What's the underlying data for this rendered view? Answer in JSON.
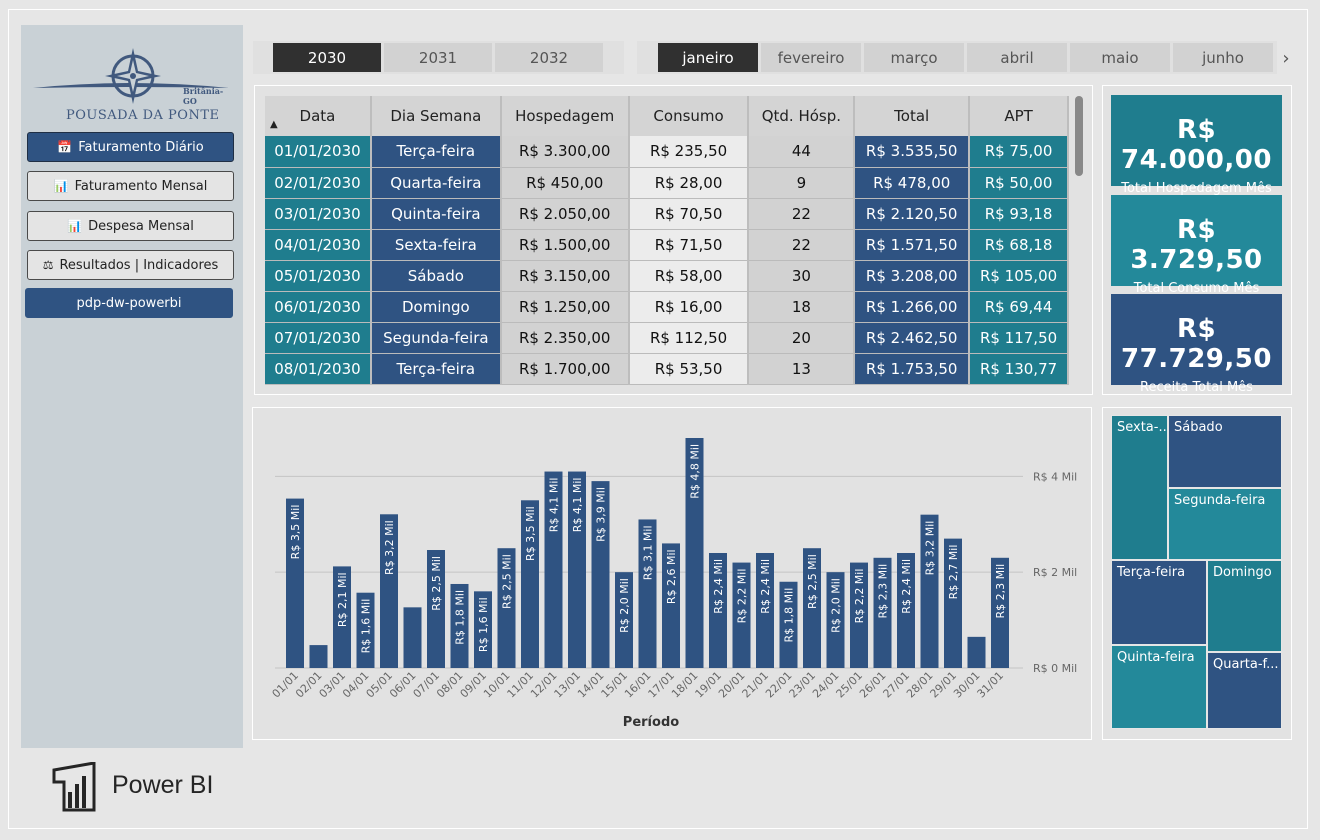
{
  "sidebar": {
    "logo": {
      "name": "Pousada da Ponte",
      "subtitle": "Britânia-GO"
    },
    "buttons": [
      {
        "label": "Faturamento Diário",
        "icon": "calendar-icon"
      },
      {
        "label": "Faturamento Mensal",
        "icon": "bar-chart-icon"
      },
      {
        "label": "Despesa Mensal",
        "icon": "bar-chart-icon"
      },
      {
        "label": "Resultados | Indicadores",
        "icon": "scale-icon"
      },
      {
        "label": "pdp-dw-powerbi",
        "icon": ""
      }
    ],
    "brand": "Power BI"
  },
  "years": [
    "2030",
    "2031",
    "2032"
  ],
  "selected_year": "2030",
  "months": [
    "janeiro",
    "fevereiro",
    "março",
    "abril",
    "maio",
    "junho"
  ],
  "selected_month": "janeiro",
  "table": {
    "columns": [
      "Data",
      "Dia Semana",
      "Hospedagem",
      "Consumo",
      "Qtd. Hósp.",
      "Total",
      "APT"
    ],
    "rows": [
      [
        "01/01/2030",
        "Terça-feira",
        "R$ 3.300,00",
        "R$ 235,50",
        "44",
        "R$ 3.535,50",
        "R$ 75,00"
      ],
      [
        "02/01/2030",
        "Quarta-feira",
        "R$ 450,00",
        "R$ 28,00",
        "9",
        "R$ 478,00",
        "R$ 50,00"
      ],
      [
        "03/01/2030",
        "Quinta-feira",
        "R$ 2.050,00",
        "R$ 70,50",
        "22",
        "R$ 2.120,50",
        "R$ 93,18"
      ],
      [
        "04/01/2030",
        "Sexta-feira",
        "R$ 1.500,00",
        "R$ 71,50",
        "22",
        "R$ 1.571,50",
        "R$ 68,18"
      ],
      [
        "05/01/2030",
        "Sábado",
        "R$ 3.150,00",
        "R$ 58,00",
        "30",
        "R$ 3.208,00",
        "R$ 105,00"
      ],
      [
        "06/01/2030",
        "Domingo",
        "R$ 1.250,00",
        "R$ 16,00",
        "18",
        "R$ 1.266,00",
        "R$ 69,44"
      ],
      [
        "07/01/2030",
        "Segunda-feira",
        "R$ 2.350,00",
        "R$ 112,50",
        "20",
        "R$ 2.462,50",
        "R$ 117,50"
      ],
      [
        "08/01/2030",
        "Terça-feira",
        "R$ 1.700,00",
        "R$ 53,50",
        "13",
        "R$ 1.753,50",
        "R$ 130,77"
      ]
    ]
  },
  "kpis": [
    {
      "value": "R$ 74.000,00",
      "label": "Total Hospedagem Mês",
      "color": "#1f7d8e"
    },
    {
      "value": "R$ 3.729,50",
      "label": "Total Consumo Mês",
      "color": "#23899a"
    },
    {
      "value": "R$ 77.729,50",
      "label": "Receita Total Mês",
      "color": "#2f5382"
    }
  ],
  "chart_data": {
    "type": "bar",
    "categories": [
      "01/01",
      "02/01",
      "03/01",
      "04/01",
      "05/01",
      "06/01",
      "07/01",
      "08/01",
      "09/01",
      "10/01",
      "11/01",
      "12/01",
      "13/01",
      "14/01",
      "15/01",
      "16/01",
      "17/01",
      "18/01",
      "19/01",
      "20/01",
      "21/01",
      "22/01",
      "23/01",
      "24/01",
      "25/01",
      "26/01",
      "27/01",
      "28/01",
      "29/01",
      "30/01",
      "31/01"
    ],
    "values": [
      3535.5,
      478,
      2120.5,
      1571.5,
      3208,
      1266,
      2462.5,
      1753.5,
      1600,
      2500,
      3500,
      4100,
      4100,
      3900,
      2000,
      3100,
      2600,
      4800,
      2400,
      2200,
      2400,
      1800,
      2500,
      2000,
      2200,
      2300,
      2400,
      3200,
      2700,
      650,
      2300
    ],
    "labels": [
      "R$ 3,5 Mil",
      "",
      "R$ 2,1 Mil",
      "R$ 1,6 Mil",
      "R$ 3,2 Mil",
      "",
      "R$ 2,5 Mil",
      "R$ 1,8 Mil",
      "R$ 1,6 Mil",
      "R$ 2,5 Mil",
      "R$ 3,5 Mil",
      "R$ 4,1 Mil",
      "R$ 4,1 Mil",
      "R$ 3,9 Mil",
      "R$ 2,0 Mil",
      "R$ 3,1 Mil",
      "R$ 2,6 Mil",
      "R$ 4,8 Mil",
      "R$ 2,4 Mil",
      "R$ 2,2 Mil",
      "R$ 2,4 Mil",
      "R$ 1,8 Mil",
      "R$ 2,5 Mil",
      "R$ 2,0 Mil",
      "R$ 2,2 Mil",
      "R$ 2,3 Mil",
      "R$ 2,4 Mil",
      "R$ 3,2 Mil",
      "R$ 2,7 Mil",
      "",
      "R$ 2,3 Mil"
    ],
    "xlabel": "Período",
    "ylabel": "",
    "ylim": [
      0,
      4800
    ],
    "yticks": [
      {
        "value": 0,
        "label": "R$ 0 Mil"
      },
      {
        "value": 2000,
        "label": "R$ 2 Mil"
      },
      {
        "value": 4000,
        "label": "R$ 4 Mil"
      }
    ],
    "grid": true,
    "bar_color": "#2f5382"
  },
  "treemap": [
    {
      "label": "Sexta-...",
      "color": "#1f7d8e"
    },
    {
      "label": "Sábado",
      "color": "#2f5382"
    },
    {
      "label": "Segunda-feira",
      "color": "#23899a"
    },
    {
      "label": "Terça-feira",
      "color": "#2f5382"
    },
    {
      "label": "Domingo",
      "color": "#1f7d8e"
    },
    {
      "label": "Quinta-feira",
      "color": "#23899a"
    },
    {
      "label": "Quarta-f...",
      "color": "#2f5382"
    }
  ]
}
